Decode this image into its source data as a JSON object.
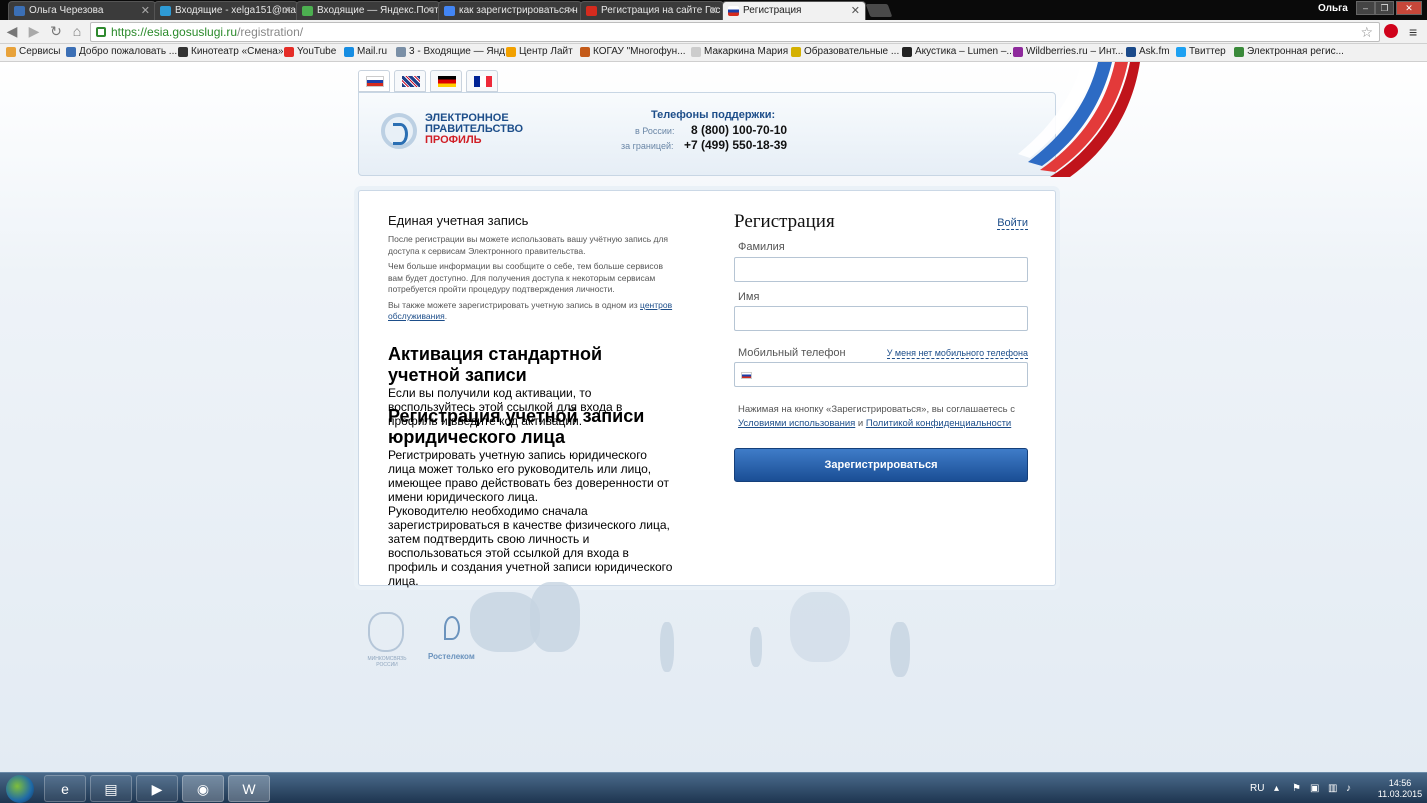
{
  "browser": {
    "tabs": [
      {
        "label": "Ольга Черезова",
        "color": "#3b6fb5"
      },
      {
        "label": "Входящие - xelga151@ma",
        "color": "#2e9bd6"
      },
      {
        "label": "Входящие — Яндекс.Почта",
        "color": "#4caf50"
      },
      {
        "label": "как зарегистрироваться н",
        "color": "#4285f4"
      },
      {
        "label": "Регистрация на сайте Гос",
        "color": "#d52b1e"
      },
      {
        "label": "Регистрация",
        "color": "#d52b1e"
      }
    ],
    "window_user": "Ольга",
    "url_host": "https://esia.gosuslugi.ru",
    "url_path": "/registration/",
    "bookmarks": [
      {
        "label": "Сервисы",
        "color": "#e8a23a"
      },
      {
        "label": "Добро пожаловать ...",
        "color": "#3b6fb5"
      },
      {
        "label": "Кинотеатр «Смена»",
        "color": "#333333"
      },
      {
        "label": "YouTube",
        "color": "#e52d27"
      },
      {
        "label": "Mail.ru",
        "color": "#168de2"
      },
      {
        "label": "3 - Входящие — Янд...",
        "color": "#7a8fa6"
      },
      {
        "label": "Центр Лайт",
        "color": "#f2a100"
      },
      {
        "label": "КОГАУ \"Многофун...",
        "color": "#c45b1a"
      },
      {
        "label": "Макаркина Мария",
        "color": "#cccccc"
      },
      {
        "label": "Образовательные ...",
        "color": "#d4b000"
      },
      {
        "label": "Акустика – Lumen –...",
        "color": "#222222"
      },
      {
        "label": "Wildberries.ru – Инт...",
        "color": "#8e2a9c"
      },
      {
        "label": "Ask.fm",
        "color": "#1b4a8a"
      },
      {
        "label": "Твиттер",
        "color": "#1da1f2"
      },
      {
        "label": "Электронная регис...",
        "color": "#3a8a3a"
      }
    ]
  },
  "header": {
    "logo_line1": "ЭЛЕКТРОННОЕ",
    "logo_line2": "ПРАВИТЕЛЬСТВО",
    "logo_line3": "ПРОФИЛЬ",
    "support_title": "Телефоны поддержки:",
    "support_ru_label": "в России:",
    "support_ru_number": "8 (800) 100-70-10",
    "support_abroad_label": "за границей:",
    "support_abroad_number": "+7 (499) 550-18-39"
  },
  "info": {
    "sec1_title": "Единая учетная запись",
    "sec1_p1": "После регистрации вы можете использовать вашу учётную запись для доступа к сервисам Электронного правительства.",
    "sec1_p2": "Чем больше информации вы сообщите о себе, тем больше сервисов вам будет доступно. Для получения доступа к некоторым сервисам потребуется пройти процедуру подтверждения личности.",
    "sec1_p3": "Вы также можете зарегистрировать учетную запись в одном из",
    "sec1_p3_link": "центров обслуживания",
    "sec2_title": "Активация стандартной учетной записи",
    "sec2_p1": "Если вы получили код активации, то воспользуйтесь",
    "sec2_p1_link": "этой ссылкой",
    "sec2_p1_end": "для входа в профиль и введите код активации.",
    "sec3_title_1": "Регистрация учетной записи",
    "sec3_title_2": "юридического лица",
    "sec3_p1": "Регистрировать учетную запись юридического лица может только его руководитель или лицо, имеющее право действовать без доверенности от имени юридического лица.",
    "sec3_p2": "Руководителю необходимо сначала зарегистрироваться в качестве физического лица, затем подтвердить свою личность и воспользоваться",
    "sec3_p2_link": "этой ссылкой",
    "sec3_p2_end": "для входа в профиль и создания учетной записи юридического лица."
  },
  "form": {
    "title": "Регистрация",
    "login_link": "Войти",
    "surname_label": "Фамилия",
    "surname_value": "",
    "name_label": "Имя",
    "name_value": "",
    "phone_label": "Мобильный телефон",
    "no_phone_link": "У меня нет мобильного телефона",
    "agree_text": "Нажимая на кнопку «Зарегистрироваться», вы соглашаетесь с",
    "terms_link": "Условиями использования",
    "and_text": "и",
    "privacy_link": "Политикой конфиденциальности",
    "submit_label": "Зарегистрироваться"
  },
  "footer": {
    "emblem_label": "МИНКОМСВЯЗЬ РОССИИ",
    "rostelecom_label": "Ростелеком"
  },
  "taskbar": {
    "lang": "RU",
    "time": "14:56",
    "date": "11.03.2015"
  },
  "colors": {
    "accent": "#1d4e8a",
    "button": "#1a4e95",
    "logo_red": "#d01e25"
  }
}
